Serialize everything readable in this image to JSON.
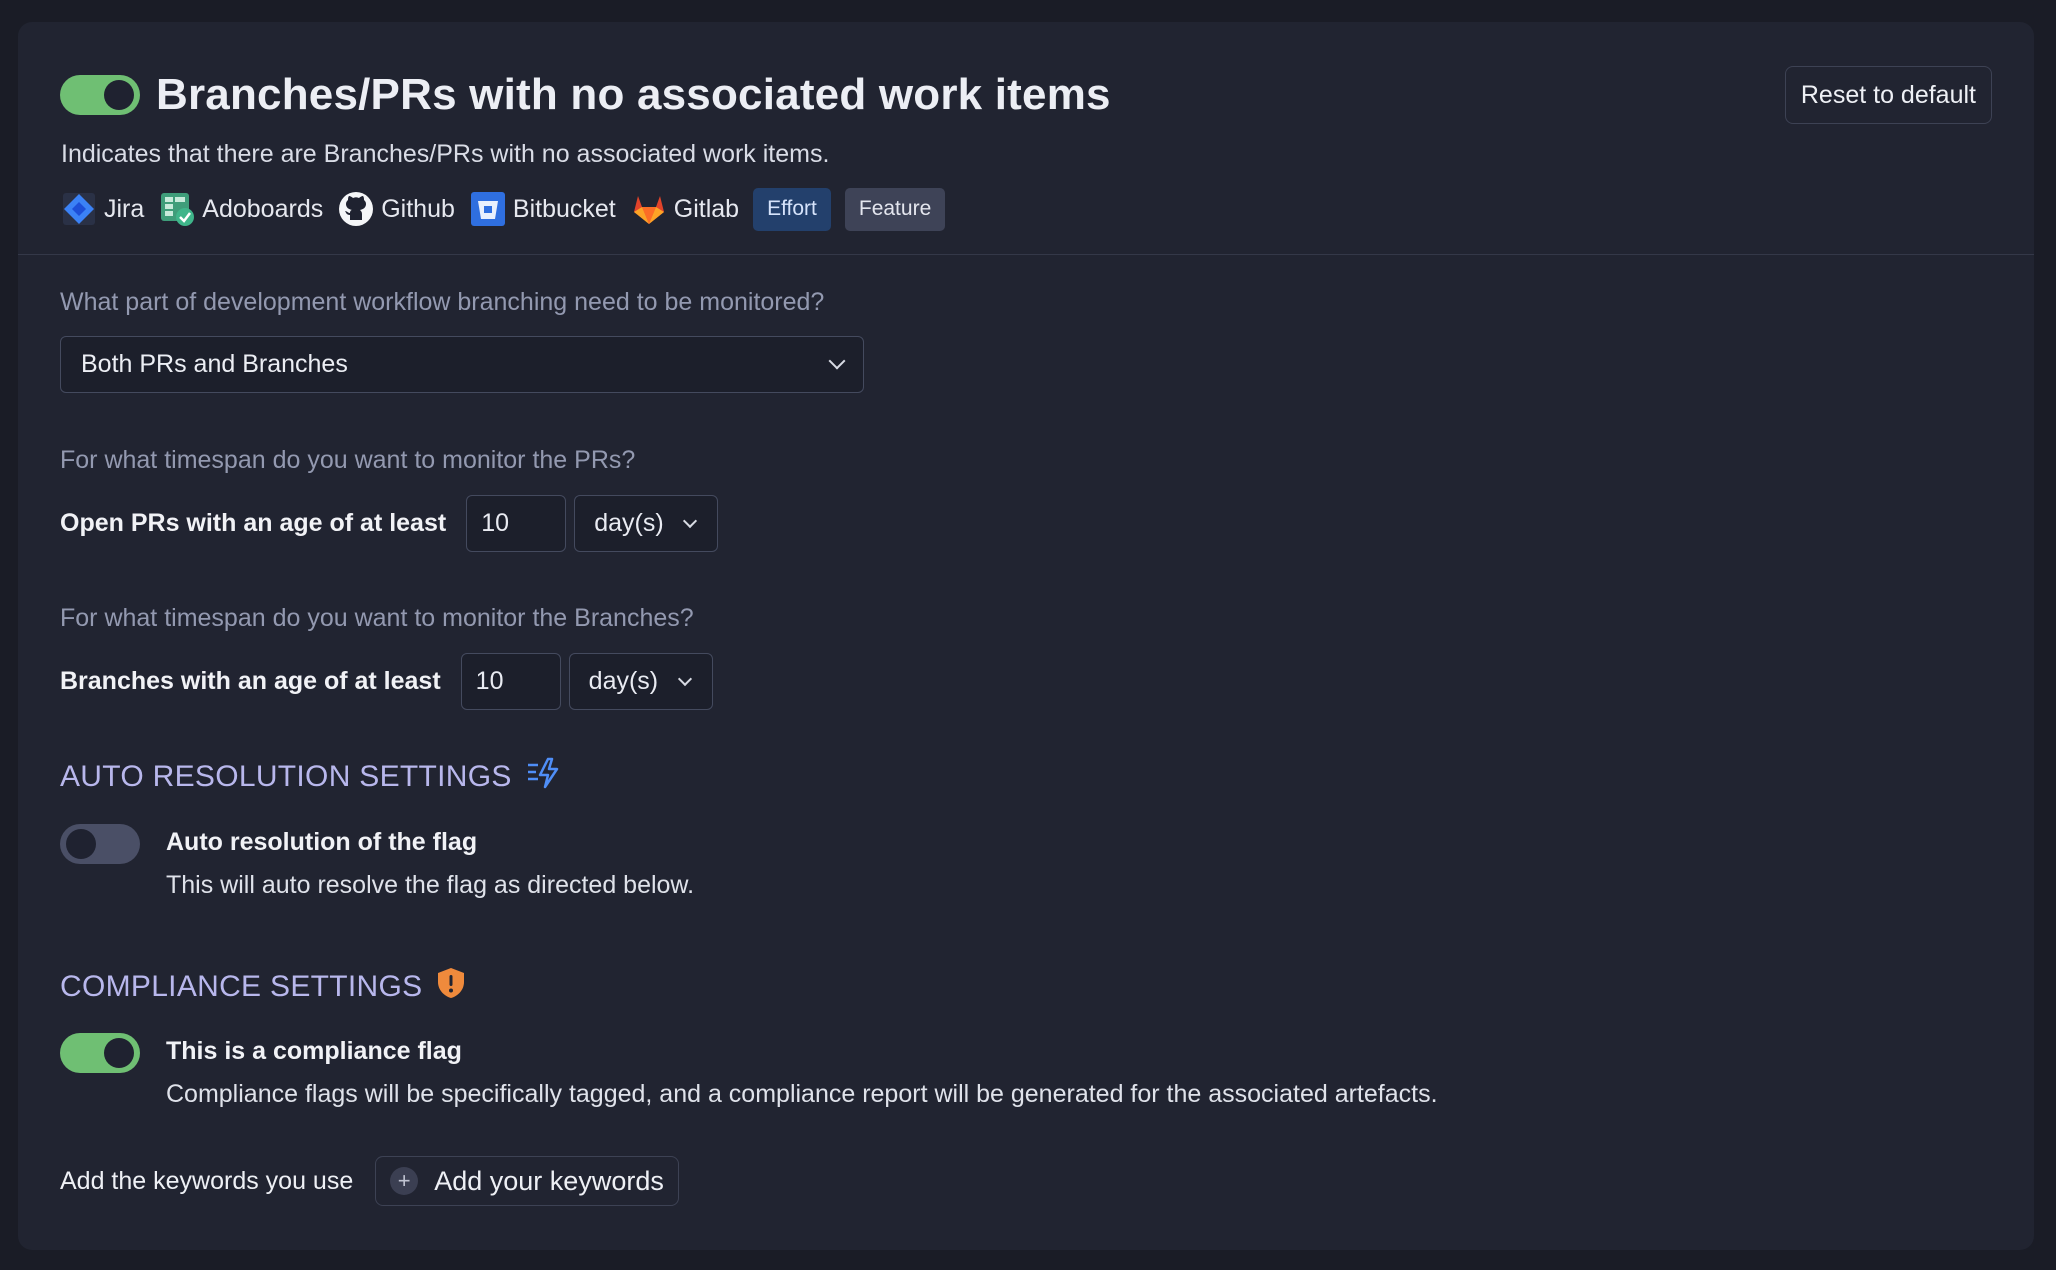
{
  "header": {
    "title": "Branches/PRs with no associated work items",
    "description": "Indicates that there are Branches/PRs with no associated work items.",
    "reset_label": "Reset to default",
    "enabled": true,
    "tools": [
      {
        "label": "Jira",
        "icon": "jira-icon"
      },
      {
        "label": "Adoboards",
        "icon": "adoboards-icon"
      },
      {
        "label": "Github",
        "icon": "github-icon"
      },
      {
        "label": "Bitbucket",
        "icon": "bitbucket-icon"
      },
      {
        "label": "Gitlab",
        "icon": "gitlab-icon"
      }
    ],
    "tags": [
      "Effort",
      "Feature"
    ]
  },
  "workflow": {
    "question": "What part of development workflow branching need to be monitored?",
    "selected": "Both PRs and Branches"
  },
  "prs": {
    "question": "For what timespan do you want to monitor the PRs?",
    "label": "Open PRs with an age of at least",
    "value": "10",
    "unit": "day(s)"
  },
  "branches": {
    "question": "For what timespan do you want to monitor the Branches?",
    "label": "Branches with an age of at least",
    "value": "10",
    "unit": "day(s)"
  },
  "auto_resolution": {
    "heading": "AUTO RESOLUTION SETTINGS",
    "title": "Auto resolution of the flag",
    "description": "This will auto resolve the flag as directed below.",
    "enabled": false
  },
  "compliance": {
    "heading": "COMPLIANCE SETTINGS",
    "title": "This is a compliance flag",
    "description": "Compliance flags will be specifically tagged, and a compliance report will be generated for the associated artefacts.",
    "enabled": true
  },
  "keywords": {
    "label": "Add the keywords you use",
    "button": "Add your keywords"
  },
  "colors": {
    "toggle_on": "#6fbf73",
    "toggle_off": "#4a4f66",
    "heading": "#b8b7ec",
    "effort_tag": "#23406c"
  }
}
